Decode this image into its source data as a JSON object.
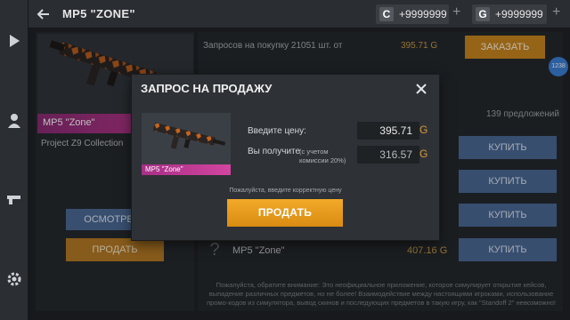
{
  "topbar": {
    "title": "MP5 \"ZONE\"",
    "credits": {
      "badge": "C",
      "amount": "+9999999"
    },
    "gold": {
      "badge": "G",
      "amount": "+9999999"
    }
  },
  "left": {
    "item_name": "MP5 \"Zone\"",
    "collection": "Project Z9 Collection",
    "inspect_label": "ОСМОТРЕТЬ",
    "sell_label": "ПРОДАТЬ"
  },
  "right": {
    "buy_requests": "Запросов на покупку 21051 шт. от",
    "buy_requests_price": "395.71 G",
    "order_label": "ЗАКАЗАТЬ",
    "offers_count": "139 предложений",
    "buy_label": "КУПИТЬ",
    "row_name": "MP5 \"Zone\"",
    "row_price": "407.16 G",
    "notice": "Пожалуйста, обратите внимание: Это неофициальное приложение, которое симулирует открытие кейсов, выпадение различных предметов, но не более! Взаимодействие между настоящими игроками, использование промо-кодов из симулятора, вывод скинов и последующих предметов в такую игру, как \"Standoff 2\" невозможно!",
    "side_badge": "1238"
  },
  "modal": {
    "title": "ЗАПРОС НА ПРОДАЖУ",
    "item_label": "MP5 \"Zone\"",
    "price_label": "Введите цену:",
    "price_value": "395.71",
    "receive_label": "Вы получите",
    "receive_note": "(с учетом комиссии 20%)",
    "receive_value": "316.57",
    "currency": "G",
    "hint": "Пожалуйста, введите корректную цену",
    "sell_label": "ПРОДАТЬ"
  },
  "colors": {
    "accent_gold": "#d98c12",
    "buy_blue": "#4a6894",
    "rarity_pink": "#c0398f"
  },
  "icons": [
    "play-icon",
    "profile-icon",
    "pistol-icon",
    "gear-icon",
    "back-arrow-icon",
    "close-icon",
    "question-icon"
  ]
}
